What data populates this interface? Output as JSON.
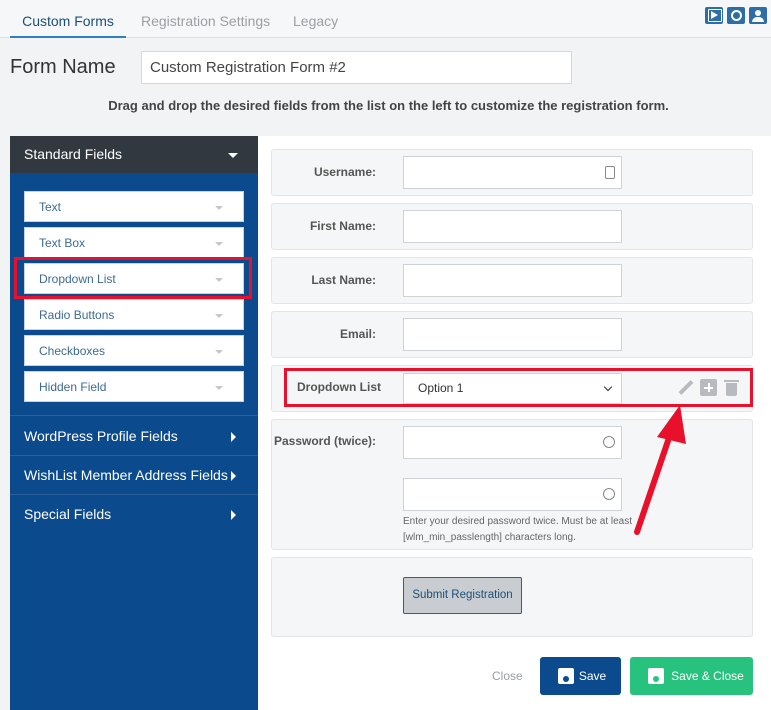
{
  "tabs": [
    "Custom Forms",
    "Registration Settings",
    "Legacy"
  ],
  "top_icons": [
    "video-icon",
    "search-icon",
    "user-icon"
  ],
  "form_name": {
    "label": "Form Name",
    "value": "Custom Registration Form #2"
  },
  "instructions": "Drag and drop the desired fields from the list on the left to customize the registration form.",
  "left_panel": {
    "standard_header": "Standard Fields",
    "standard_items": [
      "Text",
      "Text Box",
      "Dropdown List",
      "Radio Buttons",
      "Checkboxes",
      "Hidden Field"
    ],
    "sections": [
      "WordPress Profile Fields",
      "WishList Member Address Fields",
      "Special Fields"
    ]
  },
  "fields": {
    "username": "Username:",
    "first_name": "First Name:",
    "last_name": "Last Name:",
    "email": "Email:",
    "dropdown_label": "Dropdown List",
    "dropdown_value": "Option 1",
    "password": "Password (twice):",
    "password_help": "Enter your desired password twice. Must be at least [wlm_min_passlength] characters long.",
    "submit": "Submit Registration"
  },
  "actions": {
    "close": "Close",
    "save": "Save",
    "save_close": "Save & Close"
  },
  "colors": {
    "primary": "#0b4a8c",
    "success": "#27c27d",
    "highlight": "#e8102a",
    "sidebar_header": "#31383f"
  }
}
